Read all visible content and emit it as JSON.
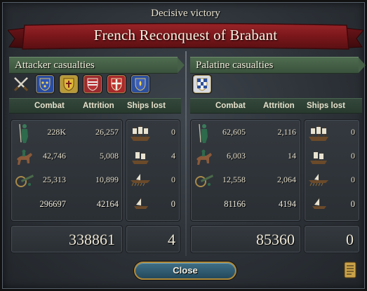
{
  "header": {
    "subtitle": "Decisive victory",
    "title": "French Reconquest of Brabant"
  },
  "attacker": {
    "title": "Attacker casualties",
    "icons": [
      "crossed-swords-icon",
      "france-shield-icon",
      "yellow-shield-icon",
      "red-white-shield-icon",
      "red-cross-shield-icon",
      "blue-fleur-shield-icon"
    ],
    "columns": {
      "combat": "Combat",
      "attrition": "Attrition",
      "ships": "Ships lost"
    },
    "rows": [
      {
        "unit": "infantry-icon",
        "combat": "228K",
        "attrition": "26,257",
        "ship": "heavy-ship-icon",
        "ships_lost": "0"
      },
      {
        "unit": "cavalry-icon",
        "combat": "42,746",
        "attrition": "5,008",
        "ship": "light-ship-icon",
        "ships_lost": "4"
      },
      {
        "unit": "artillery-icon",
        "combat": "25,313",
        "attrition": "10,899",
        "ship": "galley-icon",
        "ships_lost": "0"
      }
    ],
    "totals": {
      "combat": "296697",
      "attrition": "42164",
      "ship": "transport-icon",
      "ships_lost": "0"
    },
    "grand_total": "338861",
    "grand_ships": "4"
  },
  "defender": {
    "title": "Palatine casualties",
    "icons": [
      "palatine-checkered-shield-icon"
    ],
    "columns": {
      "combat": "Combat",
      "attrition": "Attrition",
      "ships": "Ships lost"
    },
    "rows": [
      {
        "unit": "infantry-icon",
        "combat": "62,605",
        "attrition": "2,116",
        "ship": "heavy-ship-icon",
        "ships_lost": "0"
      },
      {
        "unit": "cavalry-icon",
        "combat": "6,003",
        "attrition": "14",
        "ship": "light-ship-icon",
        "ships_lost": "0"
      },
      {
        "unit": "artillery-icon",
        "combat": "12,558",
        "attrition": "2,064",
        "ship": "galley-icon",
        "ships_lost": "0"
      }
    ],
    "totals": {
      "combat": "81166",
      "attrition": "4194",
      "ship": "transport-icon",
      "ships_lost": "0"
    },
    "grand_total": "85360",
    "grand_ships": "0"
  },
  "footer": {
    "close_label": "Close"
  },
  "colors": {
    "banner": "#7a1a1e",
    "header_green": "#4e6b4f",
    "button_blue": "#2f5c72",
    "gold": "#b08a3a"
  }
}
